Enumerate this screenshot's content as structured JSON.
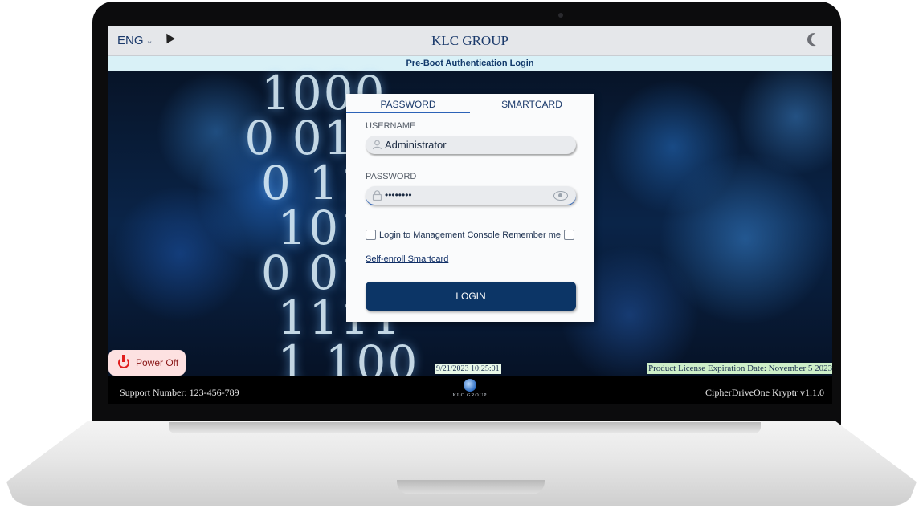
{
  "topbar": {
    "language": "ENG",
    "brand": "KLC GROUP"
  },
  "subbar": {
    "title": "Pre-Boot Authentication Login"
  },
  "login_panel": {
    "tabs": [
      {
        "label": "PASSWORD",
        "active": true
      },
      {
        "label": "SMARTCARD",
        "active": false
      }
    ],
    "username_label": "USERNAME",
    "username_value": "Administrator",
    "password_label": "PASSWORD",
    "password_value": "••••••••",
    "mgmt_console_label": "Login to Management Console",
    "remember_label": "Remember me",
    "self_enroll_link": "Self-enroll Smartcard",
    "login_button": "LOGIN"
  },
  "power": {
    "label": "Power Off"
  },
  "status": {
    "datetime": "9/21/2023 10:25:01",
    "license": "Product License Expiration Date: November 5 2023"
  },
  "footer": {
    "support": "Support Number: 123-456-789",
    "logo_text": "KLC GROUP",
    "version": "CipherDriveOne Kryptr v1.1.0"
  },
  "colors": {
    "brand_navy": "#0c3566",
    "subbar_bg": "#d9f1f7",
    "power_bg": "#fde1e1",
    "power_icon": "#e11d1d",
    "license_bg": "#cdeec8"
  }
}
